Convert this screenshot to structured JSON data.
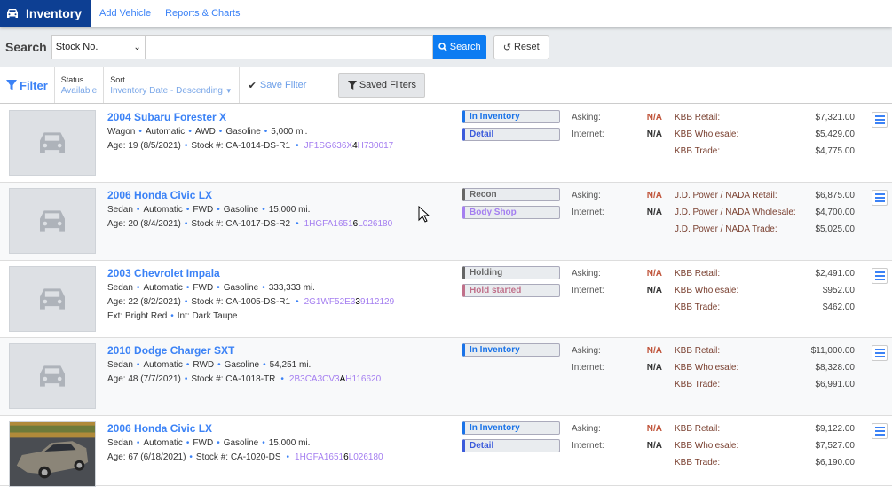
{
  "nav": {
    "brand": "Inventory",
    "links": [
      "Add Vehicle",
      "Reports & Charts"
    ]
  },
  "search": {
    "label": "Search",
    "field": "Stock No.",
    "query": "",
    "button": "Search",
    "reset": "Reset"
  },
  "filter": {
    "label": "Filter",
    "status_label": "Status",
    "status_value": "Available",
    "sort_label": "Sort",
    "sort_value": "Inventory Date - Descending",
    "save_filter": "Save Filter",
    "saved_filters": "Saved Filters"
  },
  "colors": {
    "accent": "#3b82f6",
    "brand": "#0d3f93",
    "search_button": "#0d7cf2",
    "vin": "#a47ef0"
  },
  "rows": [
    {
      "title": "2004 Subaru Forester X",
      "specs": [
        "Wagon",
        "Automatic",
        "AWD",
        "Gasoline",
        "5,000 mi."
      ],
      "age": "Age: 19 (8/5/2021)",
      "stock": "Stock #: CA-1014-DS-R1",
      "vin": [
        "JF1SG636X",
        "4",
        "H730017"
      ],
      "extra": [],
      "photo": false,
      "badges": [
        {
          "text": "In Inventory",
          "color": "#1a73e8"
        },
        {
          "text": "Detail",
          "color": "#3b5bdb"
        }
      ],
      "asking_label": "Asking:",
      "asking": "N/A",
      "internet_label": "Internet:",
      "internet": "N/A",
      "values": [
        {
          "label": "KBB Retail:",
          "amount": "$7,321.00"
        },
        {
          "label": "KBB Wholesale:",
          "amount": "$5,429.00"
        },
        {
          "label": "KBB Trade:",
          "amount": "$4,775.00"
        }
      ]
    },
    {
      "title": "2006 Honda Civic LX",
      "specs": [
        "Sedan",
        "Automatic",
        "FWD",
        "Gasoline",
        "15,000 mi."
      ],
      "age": "Age: 20 (8/4/2021)",
      "stock": "Stock #: CA-1017-DS-R2",
      "vin": [
        "1HGFA1651",
        "6",
        "L026180"
      ],
      "extra": [],
      "photo": false,
      "badges": [
        {
          "text": "Recon",
          "color": "#666666"
        },
        {
          "text": "Body Shop",
          "color": "#a47ef0"
        }
      ],
      "asking_label": "Asking:",
      "asking": "N/A",
      "internet_label": "Internet:",
      "internet": "N/A",
      "values": [
        {
          "label": "J.D. Power / NADA Retail:",
          "amount": "$6,875.00"
        },
        {
          "label": "J.D. Power / NADA Wholesale:",
          "amount": "$4,700.00"
        },
        {
          "label": "J.D. Power / NADA Trade:",
          "amount": "$5,025.00"
        }
      ]
    },
    {
      "title": "2003 Chevrolet Impala",
      "specs": [
        "Sedan",
        "Automatic",
        "FWD",
        "Gasoline",
        "333,333 mi."
      ],
      "age": "Age: 22 (8/2/2021)",
      "stock": "Stock #: CA-1005-DS-R1",
      "vin": [
        "2G1WF52E3",
        "3",
        "9112129"
      ],
      "extra": [
        "Ext: Bright Red",
        "Int: Dark Taupe"
      ],
      "photo": false,
      "badges": [
        {
          "text": "Holding",
          "color": "#666666"
        },
        {
          "text": "Hold started",
          "color": "#c0708a"
        }
      ],
      "asking_label": "Asking:",
      "asking": "N/A",
      "internet_label": "Internet:",
      "internet": "N/A",
      "values": [
        {
          "label": "KBB Retail:",
          "amount": "$2,491.00"
        },
        {
          "label": "KBB Wholesale:",
          "amount": "$952.00"
        },
        {
          "label": "KBB Trade:",
          "amount": "$462.00"
        }
      ]
    },
    {
      "title": "2010 Dodge Charger SXT",
      "specs": [
        "Sedan",
        "Automatic",
        "RWD",
        "Gasoline",
        "54,251 mi."
      ],
      "age": "Age: 48 (7/7/2021)",
      "stock": "Stock #: CA-1018-TR",
      "vin": [
        "2B3CA3CV3",
        "A",
        "H116620"
      ],
      "extra": [],
      "photo": false,
      "badges": [
        {
          "text": "In Inventory",
          "color": "#1a73e8"
        }
      ],
      "asking_label": "Asking:",
      "asking": "N/A",
      "internet_label": "Internet:",
      "internet": "N/A",
      "values": [
        {
          "label": "KBB Retail:",
          "amount": "$11,000.00"
        },
        {
          "label": "KBB Wholesale:",
          "amount": "$8,328.00"
        },
        {
          "label": "KBB Trade:",
          "amount": "$6,991.00"
        }
      ]
    },
    {
      "title": "2006 Honda Civic LX",
      "specs": [
        "Sedan",
        "Automatic",
        "FWD",
        "Gasoline",
        "15,000 mi."
      ],
      "age": "Age: 67 (6/18/2021)",
      "stock": "Stock #: CA-1020-DS",
      "vin": [
        "1HGFA1651",
        "6",
        "L026180"
      ],
      "extra": [],
      "photo": true,
      "badges": [
        {
          "text": "In Inventory",
          "color": "#1a73e8"
        },
        {
          "text": "Detail",
          "color": "#3b5bdb"
        }
      ],
      "asking_label": "Asking:",
      "asking": "N/A",
      "internet_label": "Internet:",
      "internet": "N/A",
      "values": [
        {
          "label": "KBB Retail:",
          "amount": "$9,122.00"
        },
        {
          "label": "KBB Wholesale:",
          "amount": "$7,527.00"
        },
        {
          "label": "KBB Trade:",
          "amount": "$6,190.00"
        }
      ]
    }
  ]
}
